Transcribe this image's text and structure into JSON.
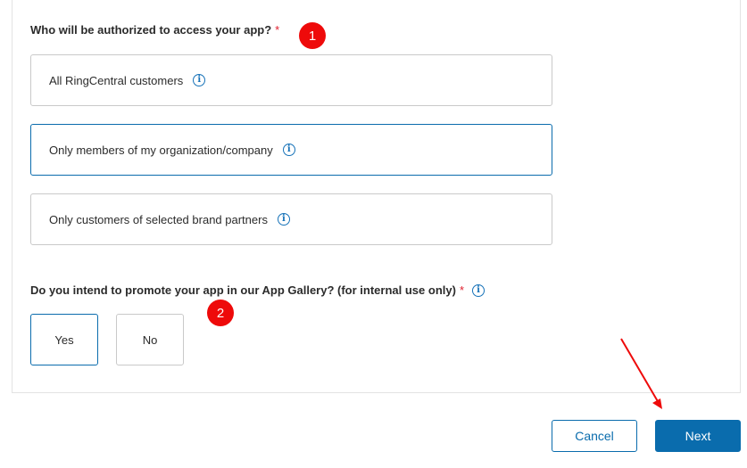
{
  "question1": {
    "label": "Who will be authorized to access your app?",
    "required_mark": "*",
    "options": [
      {
        "label": "All RingCentral customers",
        "selected": false
      },
      {
        "label": "Only members of my organization/company",
        "selected": true
      },
      {
        "label": "Only customers of selected brand partners",
        "selected": false
      }
    ]
  },
  "question2": {
    "label": "Do you intend to promote your app in our App Gallery? (for internal use only)",
    "required_mark": "*",
    "choices": [
      {
        "label": "Yes",
        "selected": true
      },
      {
        "label": "No",
        "selected": false
      }
    ]
  },
  "annotations": {
    "badge1": "1",
    "badge2": "2",
    "badge_color": "#ee0a0a",
    "arrow_color": "#ee0a0a"
  },
  "footer": {
    "cancel_label": "Cancel",
    "next_label": "Next"
  },
  "colors": {
    "accent": "#0a6cad",
    "required": "#e0202f",
    "info_icon": "#1672b8"
  }
}
